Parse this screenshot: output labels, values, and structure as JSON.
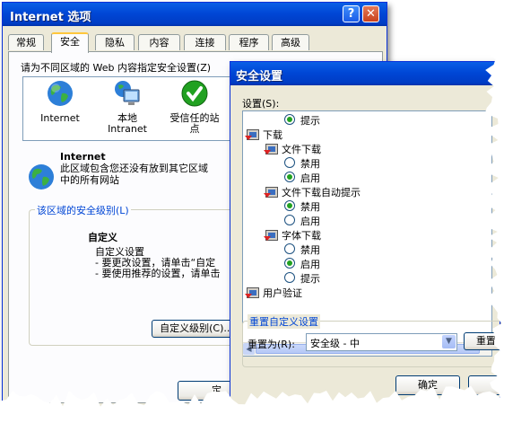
{
  "internet_options": {
    "title": "Internet 选项",
    "help_btn": "?",
    "close_btn": "✕",
    "tabs": [
      "常规",
      "安全",
      "隐私",
      "内容",
      "连接",
      "程序",
      "高级"
    ],
    "active_tab": "安全",
    "zones_prompt": "请为不同区域的 Web 内容指定安全设置(Z)",
    "zones": [
      {
        "label": "Internet",
        "icon": "globe-icon"
      },
      {
        "label": "本地\nIntranet",
        "icon": "intranet-icon"
      },
      {
        "label": "受信任的站\n点",
        "icon": "check-icon"
      }
    ],
    "zone_title": "Internet",
    "zone_desc": "此区域包含您还没有放到其它区域\n中的所有网站",
    "security_level_label": "该区域的安全级别(L)",
    "custom_title": "自定义",
    "custom_line1": "自定义设置",
    "custom_line2": "- 要更改设置，请单击“自定",
    "custom_line3": "- 要使用推荐的设置，请单击",
    "custom_level_button": "自定义级别(C)...",
    "ok_button_partial": "定"
  },
  "security_settings": {
    "title": "安全设置",
    "settings_label": "设置(S):",
    "tree": [
      {
        "type": "radio",
        "indent": 2,
        "label": "提示",
        "checked": true
      },
      {
        "type": "category",
        "indent": 0,
        "label": "下载"
      },
      {
        "type": "category",
        "indent": 1,
        "label": "文件下载"
      },
      {
        "type": "radio",
        "indent": 2,
        "label": "禁用",
        "checked": false
      },
      {
        "type": "radio",
        "indent": 2,
        "label": "启用",
        "checked": true
      },
      {
        "type": "category",
        "indent": 1,
        "label": "文件下载自动提示"
      },
      {
        "type": "radio",
        "indent": 2,
        "label": "禁用",
        "checked": true
      },
      {
        "type": "radio",
        "indent": 2,
        "label": "启用",
        "checked": false
      },
      {
        "type": "category",
        "indent": 1,
        "label": "字体下载"
      },
      {
        "type": "radio",
        "indent": 2,
        "label": "禁用",
        "checked": false
      },
      {
        "type": "radio",
        "indent": 2,
        "label": "启用",
        "checked": true
      },
      {
        "type": "radio",
        "indent": 2,
        "label": "提示",
        "checked": false
      },
      {
        "type": "category",
        "indent": 0,
        "label": "用户验证"
      }
    ],
    "reset_group_label": "重置自定义设置",
    "reset_to_label": "重置为(R):",
    "reset_level_value": "安全级 - 中",
    "reset_button": "重置",
    "ok_button": "确定"
  },
  "colors": {
    "title_bar": "#0047d6",
    "dialog_bg": "#ece9d8",
    "group_label": "#0046d5"
  }
}
